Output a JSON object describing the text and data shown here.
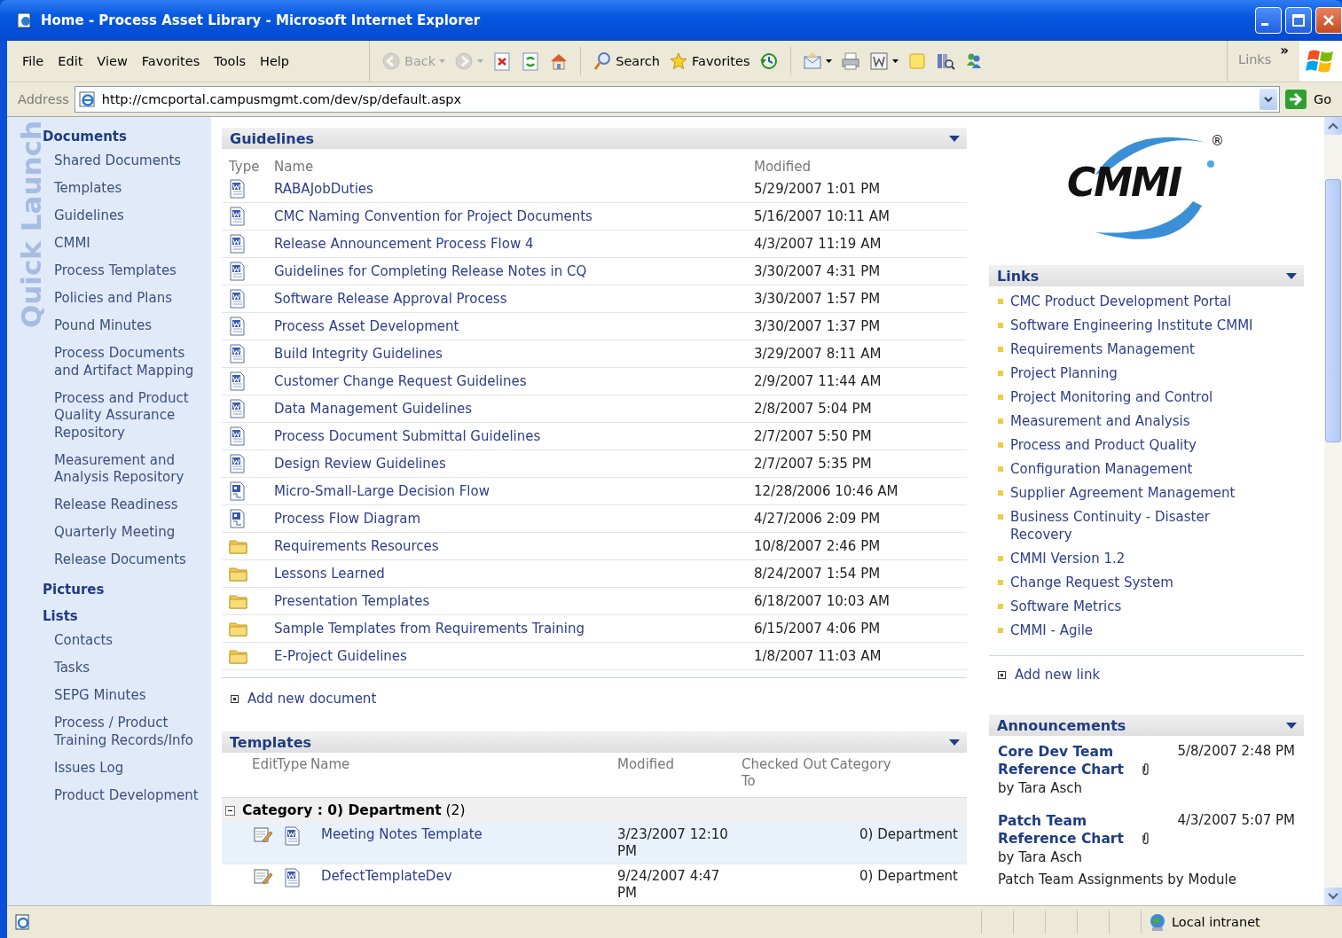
{
  "window": {
    "title": "Home - Process Asset Library - Microsoft Internet Explorer"
  },
  "menu": [
    "File",
    "Edit",
    "View",
    "Favorites",
    "Tools",
    "Help"
  ],
  "toolbar": [
    {
      "kind": "back",
      "label": "Back",
      "disabled": true,
      "menu": true
    },
    {
      "kind": "forward",
      "disabled": true,
      "menu": true
    },
    {
      "kind": "stop",
      "disabled": false,
      "menu": false
    },
    {
      "kind": "refresh",
      "disabled": false,
      "menu": false
    },
    {
      "kind": "home",
      "disabled": false,
      "menu": false
    },
    {
      "kind": "search",
      "label": "Search",
      "disabled": false,
      "menu": false
    },
    {
      "kind": "favorites",
      "label": "Favorites",
      "disabled": false,
      "menu": false
    },
    {
      "kind": "history",
      "disabled": false,
      "menu": false
    },
    {
      "kind": "mail",
      "disabled": false,
      "menu": true
    },
    {
      "kind": "print",
      "disabled": false,
      "menu": false
    },
    {
      "kind": "edit",
      "disabled": false,
      "menu": true
    },
    {
      "kind": "notes",
      "disabled": false,
      "menu": false
    },
    {
      "kind": "research",
      "disabled": false,
      "menu": false
    },
    {
      "kind": "messenger",
      "disabled": false,
      "menu": false
    }
  ],
  "links_bar": {
    "label": "Links",
    "more": "»"
  },
  "address": {
    "label": "Address",
    "value": "http://cmcportal.campusmgmt.com/dev/sp/default.aspx",
    "go": "Go"
  },
  "quick_launch": {
    "watermark": "Quick Launch",
    "sections": [
      {
        "label": "Documents",
        "children": [
          {
            "label": "Shared Documents"
          },
          {
            "label": "Templates"
          },
          {
            "label": "Guidelines"
          },
          {
            "label": "CMMI"
          },
          {
            "label": "Process Templates"
          },
          {
            "label": "Policies and Plans"
          },
          {
            "label": "Pound Minutes"
          },
          {
            "label": "Process Documents and Artifact Mapping"
          },
          {
            "label": "Process and Product Quality Assurance Repository"
          },
          {
            "label": "Measurement and Analysis Repository"
          },
          {
            "label": "Release Readiness"
          },
          {
            "label": "Quarterly Meeting"
          },
          {
            "label": "Release Documents"
          }
        ]
      },
      {
        "label": "Pictures"
      },
      {
        "label": "Lists",
        "children": [
          {
            "label": "Contacts"
          },
          {
            "label": "Tasks"
          },
          {
            "label": "SEPG Minutes"
          },
          {
            "label": "Process / Product Training Records/Info"
          },
          {
            "label": "Issues Log"
          },
          {
            "label": "Product Development"
          }
        ]
      }
    ]
  },
  "guidelines": {
    "title": "Guidelines",
    "columns": [
      "Type",
      "Name",
      "Modified"
    ],
    "rows": [
      {
        "kind": "word",
        "name": "RABAJobDuties",
        "modified": "5/29/2007 1:01 PM"
      },
      {
        "kind": "word",
        "name": "CMC Naming Convention for Project Documents",
        "modified": "5/16/2007 10:11 AM"
      },
      {
        "kind": "word",
        "name": "Release Announcement Process Flow 4",
        "modified": "4/3/2007 11:19 AM"
      },
      {
        "kind": "word",
        "name": "Guidelines for Completing Release Notes in CQ",
        "modified": "3/30/2007 4:31 PM"
      },
      {
        "kind": "word",
        "name": "Software Release Approval Process",
        "modified": "3/30/2007 1:57 PM"
      },
      {
        "kind": "word",
        "name": "Process Asset Development",
        "modified": "3/30/2007 1:37 PM"
      },
      {
        "kind": "word",
        "name": "Build Integrity Guidelines",
        "modified": "3/29/2007 8:11 AM"
      },
      {
        "kind": "word",
        "name": "Customer Change Request Guidelines",
        "modified": "2/9/2007 11:44 AM"
      },
      {
        "kind": "word",
        "name": "Data Management Guidelines",
        "modified": "2/8/2007 5:04 PM"
      },
      {
        "kind": "word",
        "name": "Process Document Submittal Guidelines",
        "modified": "2/7/2007 5:50 PM"
      },
      {
        "kind": "word",
        "name": "Design Review Guidelines",
        "modified": "2/7/2007 5:35 PM"
      },
      {
        "kind": "diagram",
        "name": "Micro-Small-Large Decision Flow",
        "modified": "12/28/2006 10:46 AM"
      },
      {
        "kind": "diagram",
        "name": "Process Flow Diagram",
        "modified": "4/27/2006 2:09 PM"
      },
      {
        "kind": "folder",
        "name": "Requirements Resources",
        "modified": "10/8/2007 2:46 PM"
      },
      {
        "kind": "folder",
        "name": "Lessons Learned",
        "modified": "8/24/2007 1:54 PM"
      },
      {
        "kind": "folder",
        "name": "Presentation Templates",
        "modified": "6/18/2007 10:03 AM"
      },
      {
        "kind": "folder",
        "name": "Sample Templates from Requirements Training",
        "modified": "6/15/2007 4:06 PM"
      },
      {
        "kind": "folder",
        "name": "E-Project Guidelines",
        "modified": "1/8/2007 11:03 AM"
      }
    ],
    "add": "Add new document"
  },
  "templates": {
    "title": "Templates",
    "columns": [
      "Edit",
      "Type",
      "Name",
      "Modified",
      "Checked Out To",
      "Category"
    ],
    "group": {
      "label": "**Category : 0) Department** (2)",
      "expanded": true
    },
    "rows": [
      {
        "kind": "word",
        "name": "Meeting Notes Template",
        "modified": "3/23/2007 12:10 PM",
        "category": "0) Department",
        "selected": true
      },
      {
        "kind": "word",
        "name": "DefectTemplateDev",
        "modified": "9/24/2007 4:47 PM",
        "category": "0) Department",
        "selected": false
      }
    ]
  },
  "logo": {
    "text": "CMMI",
    "mark": "®"
  },
  "links": {
    "title": "Links",
    "items": [
      "CMC Product Development Portal",
      "Software Engineering Institute CMMI",
      "Requirements Management",
      "Project Planning",
      "Project Monitoring and Control",
      "Measurement and Analysis",
      "Process and Product Quality",
      "Configuration Management",
      "Supplier Agreement Management",
      "Business Continuity - Disaster Recovery",
      "CMMI Version 1.2",
      "Change Request System",
      "Software Metrics",
      "CMMI - Agile"
    ],
    "add": "Add new link"
  },
  "announcements": {
    "title": "Announcements",
    "items": [
      {
        "title": "Core Dev Team Reference Chart",
        "date": "5/8/2007 2:48 PM",
        "attachment": true,
        "author": "by Tara Asch"
      },
      {
        "title": "Patch Team Reference Chart",
        "date": "4/3/2007 5:07 PM",
        "attachment": true,
        "author": "by Tara Asch",
        "body": "Patch Team Assignments by Module"
      }
    ]
  },
  "status_bar": {
    "zone": "Local intranet"
  }
}
